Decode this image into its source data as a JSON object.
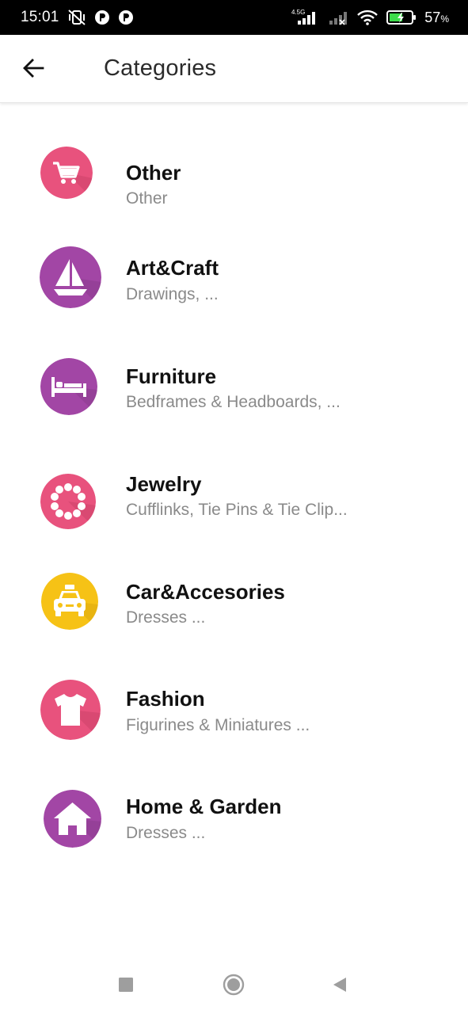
{
  "status_bar": {
    "time": "15:01",
    "network_label": "4.5G",
    "battery_percent": "57",
    "battery_suffix": "%",
    "icons": [
      "mute-vibrate-icon",
      "app-notification-icon",
      "app-notification-icon",
      "signal-icon",
      "no-signal-icon",
      "wifi-icon",
      "battery-charging-icon"
    ]
  },
  "app_bar": {
    "title": "Categories",
    "back_icon": "arrow-left-icon"
  },
  "categories": [
    {
      "title": "Other",
      "subtitle": "Other",
      "icon": "cart-icon",
      "color": "#e8527d"
    },
    {
      "title": "Art&Craft",
      "subtitle": "Drawings,  ...",
      "icon": "sailboat-icon",
      "color": "#a246a5"
    },
    {
      "title": "Furniture",
      "subtitle": "Bedframes & Headboards,  ...",
      "icon": "bed-icon",
      "color": "#a246a5"
    },
    {
      "title": "Jewelry",
      "subtitle": "Cufflinks, Tie Pins & Tie Clip...",
      "icon": "necklace-icon",
      "color": "#e8527d"
    },
    {
      "title": "Car&Accesories",
      "subtitle": "Dresses ...",
      "icon": "taxi-icon",
      "color": "#f6c216"
    },
    {
      "title": "Fashion",
      "subtitle": "Figurines & Miniatures ...",
      "icon": "tshirt-icon",
      "color": "#e8527d"
    },
    {
      "title": "Home & Garden",
      "subtitle": "Dresses ...",
      "icon": "house-icon",
      "color": "#a246a5"
    }
  ],
  "nav_bar": {
    "buttons": [
      "recent-apps-icon",
      "home-icon",
      "back-triangle-icon"
    ]
  }
}
